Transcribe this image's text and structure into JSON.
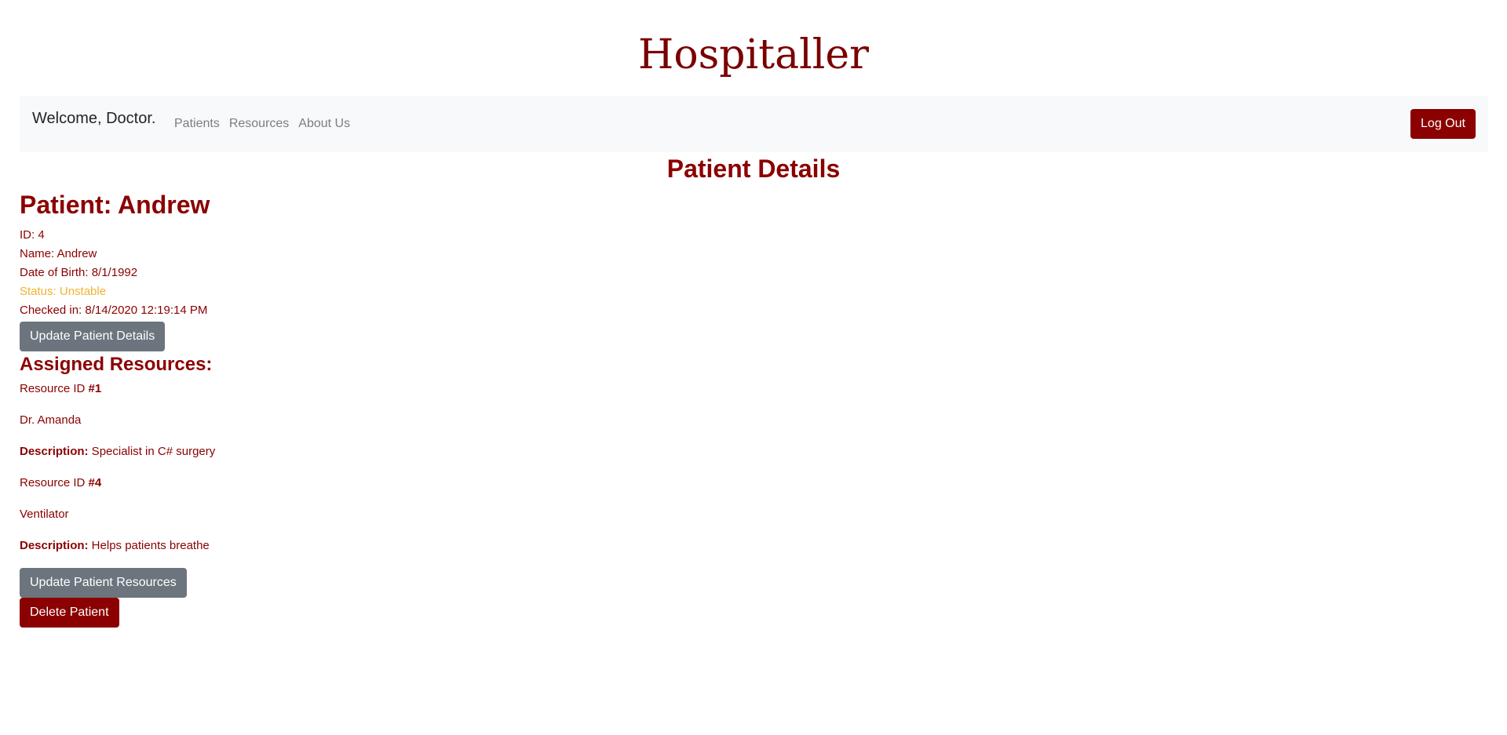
{
  "site": {
    "title": "Hospitaller"
  },
  "navbar": {
    "brand": "Welcome, Doctor.",
    "links": [
      "Patients",
      "Resources",
      "About Us"
    ],
    "logout_label": "Log Out"
  },
  "page": {
    "heading": "Patient Details"
  },
  "patient": {
    "heading": "Patient: Andrew",
    "id_line": "ID: 4",
    "name_line": "Name: Andrew",
    "dob_line": "Date of Birth: 8/1/1992",
    "status_line": "Status: Unstable",
    "checked_in_line": "Checked in: 8/14/2020 12:19:14 PM",
    "update_details_label": "Update Patient Details"
  },
  "resources": {
    "heading": "Assigned Resources:",
    "id_prefix": "Resource ID ",
    "description_label": "Description:",
    "items": [
      {
        "id": "#1",
        "name": "Dr. Amanda",
        "description": " Specialist in C# surgery"
      },
      {
        "id": "#4",
        "name": "Ventilator",
        "description": " Helps patients breathe"
      }
    ],
    "update_resources_label": "Update Patient Resources",
    "delete_label": "Delete Patient"
  },
  "colors": {
    "primary": "#8b0000",
    "status_unstable": "#f0b232",
    "secondary_button": "#6c757d",
    "navbar_bg": "#f8f9fa"
  }
}
